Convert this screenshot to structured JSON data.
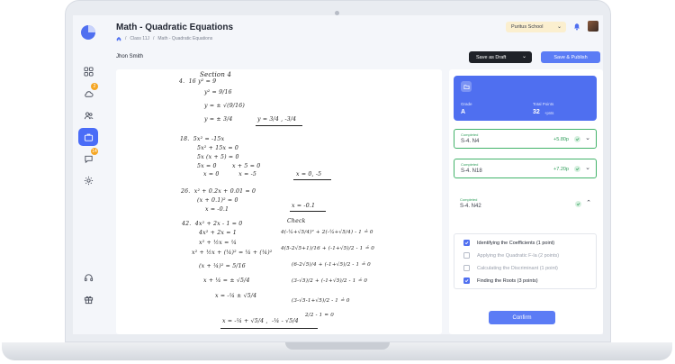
{
  "header": {
    "title": "Math - Quadratic Equations",
    "breadcrumb": {
      "class": "Class 11J",
      "page": "Math - Quadratic Equations",
      "separator": "/"
    },
    "school": "Puritus School"
  },
  "toolbar": {
    "student_name": "Jhon Smith",
    "save_draft_label": "Save as Draft",
    "save_publish_label": "Save & Publish"
  },
  "sidebar": {
    "items": [
      {
        "icon": "grid-icon"
      },
      {
        "icon": "cloud-icon",
        "badge": "2"
      },
      {
        "icon": "users-icon"
      },
      {
        "icon": "briefcase-icon",
        "active": true
      },
      {
        "icon": "chat-icon",
        "badge": "14"
      },
      {
        "icon": "gear-icon"
      },
      {
        "icon": "headset-icon"
      },
      {
        "icon": "gift-icon"
      }
    ]
  },
  "grade_card": {
    "grade_label": "Grade",
    "grade_value": "A",
    "points_label": "Total Points",
    "points_value": "32",
    "points_unit": "+pnts"
  },
  "questions": [
    {
      "status": "Completed",
      "name": "S-4. N4",
      "score": "+5.80p"
    },
    {
      "status": "Completed",
      "name": "S-4. N18",
      "score": "+7.20p"
    },
    {
      "status": "Completed",
      "name": "S-4. N42",
      "score": ""
    }
  ],
  "criteria": [
    {
      "label": "Identifying the Coefficients (1 point)",
      "checked": true
    },
    {
      "label": "Applying the Quadratic F-la (2 points)",
      "checked": false
    },
    {
      "label": "Calculating the Discriminant (1 point)",
      "checked": false
    },
    {
      "label": "Finding the Roots (3 points)",
      "checked": true
    }
  ],
  "confirm_label": "Confirm",
  "worksheet": {
    "section": "Section 4",
    "lines_left": [
      "4.  16 y² = 9",
      "y² = 9/16",
      "y = ± √(9/16)",
      "y = ± 3/4",
      "18.  5x² = -15x",
      "5x² + 15x = 0",
      "5x (x + 5) = 0",
      "5x = 0        x + 5 = 0",
      "x = 0          x = -5",
      "26.  x² + 0.2x + 0.01 = 0",
      "(x + 0.1)² = 0",
      "x = -0.1",
      "42.  4x² + 2x - 1 = 0",
      "4x² + 2x = 1",
      "x² + ½x = ¼",
      "x² + ½x + (¼)² = ¼ + (¼)²",
      "(x + ¼)² = 5/16",
      "x + ¼ = ± √5/4",
      "x = -¼ ± √5/4",
      "x = -¼ + √5/4 ,  -¼ - √5/4"
    ],
    "answers": [
      "y = 3/4 , -3/4",
      "x = 0, -5",
      "x = -0.1"
    ],
    "check_label": "Check",
    "check_lines": [
      "4(-¼+√5/4)² + 2(-¼+√5/4) - 1 ≟ 0",
      "4(5-2√5+1)/16 + (-1+√5)/2 - 1 ≟ 0",
      "(6-2√5)/4 + (-1+√5)/2 - 1 ≟ 0",
      "(3-√5)/2 + (-1+√5)/2 - 1 ≟ 0",
      "(3-√5-1+√5)/2 - 1 ≟ 0",
      "2/2 - 1 = 0"
    ]
  },
  "colors": {
    "accent": "#4f6ff0",
    "success": "#42b36a",
    "draft_button": "#1f2228",
    "school_badge": "#fbefcf"
  }
}
